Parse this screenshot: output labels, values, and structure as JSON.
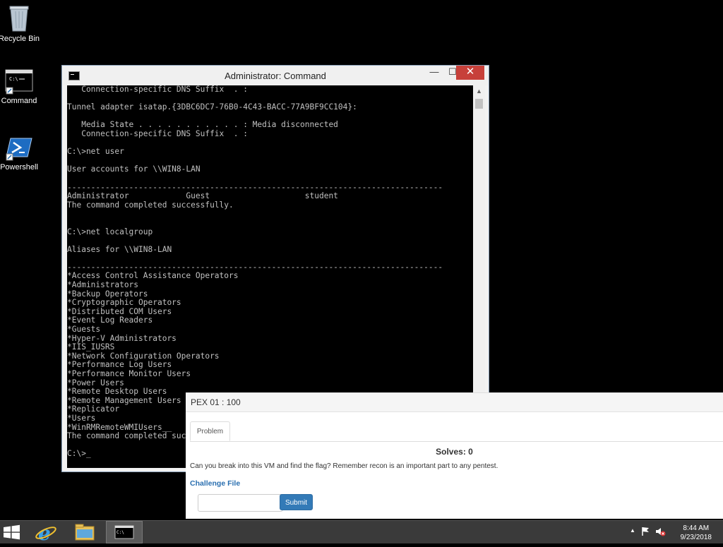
{
  "desktop": {
    "icons": [
      {
        "label": "Recycle Bin"
      },
      {
        "label": "Command"
      },
      {
        "label": "Powershell"
      }
    ]
  },
  "cmd_window": {
    "title": "Administrator: Command",
    "close_glyph": "✕",
    "min_glyph": "—",
    "max_glyph": "☐",
    "console_text": "   Connection-specific DNS Suffix  . :\n\nTunnel adapter isatap.{3DBC6DC7-76B0-4C43-BACC-77A9BF9CC104}:\n\n   Media State . . . . . . . . . . . : Media disconnected\n   Connection-specific DNS Suffix  . :\n\nC:\\>net user\n\nUser accounts for \\\\WIN8-LAN\n\n-------------------------------------------------------------------------------\nAdministrator            Guest                    student\nThe command completed successfully.\n\n\nC:\\>net localgroup\n\nAliases for \\\\WIN8-LAN\n\n-------------------------------------------------------------------------------\n*Access Control Assistance Operators\n*Administrators\n*Backup Operators\n*Cryptographic Operators\n*Distributed COM Users\n*Event Log Readers\n*Guests\n*Hyper-V Administrators\n*IIS_IUSRS\n*Network Configuration Operators\n*Performance Log Users\n*Performance Monitor Users\n*Power Users\n*Remote Desktop Users\n*Remote Management Users\n*Replicator\n*Users\n*WinRMRemoteWMIUsers__\nThe command completed successfully.\n\nC:\\>_"
  },
  "challenge": {
    "header": "PEX 01 : 100",
    "tab": "Problem",
    "solves": "Solves: 0",
    "description": "Can you break into this VM and find the flag? Remember recon is an important part to any pentest.",
    "file_link": "Challenge File",
    "input_value": "",
    "submit_label": "Submit"
  },
  "taskbar": {
    "time": "8:44 AM",
    "date": "9/23/2018"
  },
  "colors": {
    "accent": "#337ab7",
    "close_button": "#c7403a",
    "link": "#2a6fb0"
  }
}
